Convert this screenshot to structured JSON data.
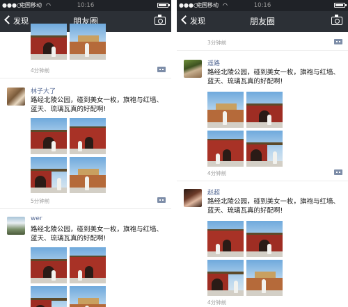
{
  "status": {
    "carrier": "中国移动",
    "time": "10:16",
    "signal_icon": "●●●○○",
    "wifi_icon": "wifi-icon"
  },
  "nav": {
    "back_label": "发现",
    "title": "朋友圈",
    "camera_icon": "camera-icon"
  },
  "left_screen": {
    "top_time": "4分钟前",
    "posts": [
      {
        "name": "林子大了",
        "text": "路经北陵公园，碰到美女一枚，旗袍与红墙、蓝天、琉璃瓦真的好配啊!",
        "time": "5分钟前"
      },
      {
        "name": "wer",
        "text": "路经北陵公园，碰到美女一枚，旗袍与红墙、蓝天、琉璃瓦真的好配啊!"
      }
    ]
  },
  "right_screen": {
    "top_time": "3分钟前",
    "posts": [
      {
        "name": "遥路",
        "text": "路经北陵公园，碰到美女一枚，旗袍与红墙、蓝天、琉璃瓦真的好配啊!",
        "time": "4分钟前"
      },
      {
        "name": "赵超",
        "text": "路经北陵公园，碰到美女一枚，旗袍与红墙、蓝天、琉璃瓦真的好配啊!",
        "time": "4分钟前"
      }
    ]
  }
}
